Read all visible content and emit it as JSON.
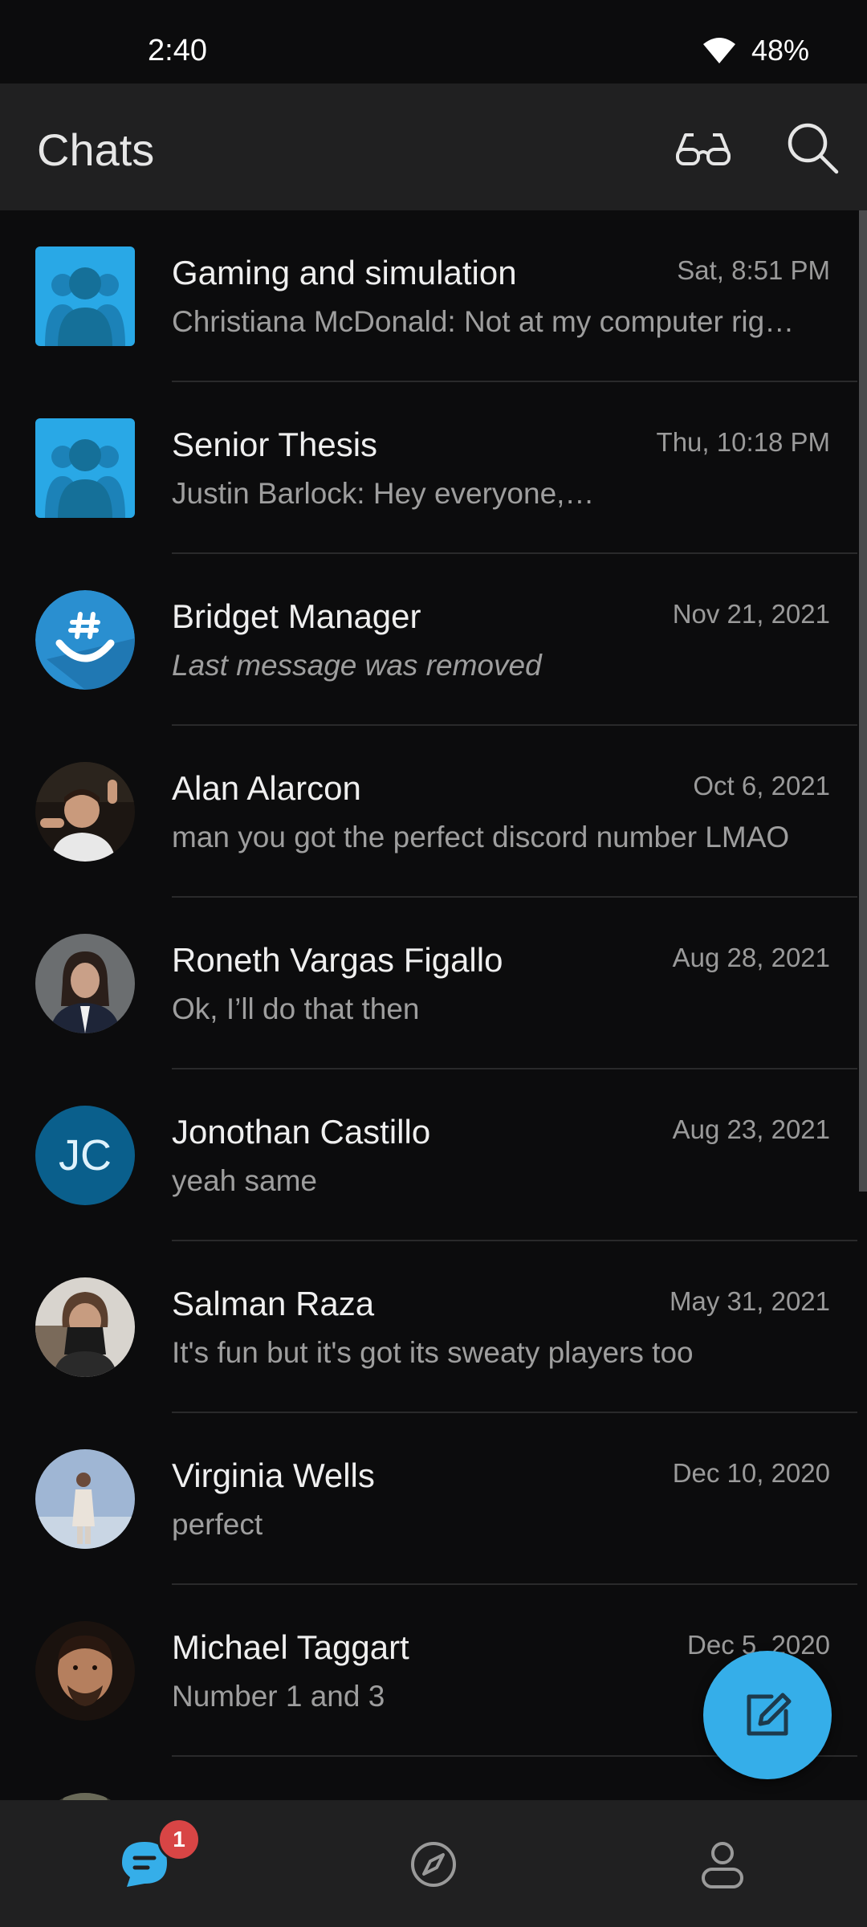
{
  "status": {
    "time": "2:40",
    "battery": "48%"
  },
  "header": {
    "title": "Chats"
  },
  "chats": [
    {
      "name": "Gaming and simulation",
      "date": "Sat, 8:51 PM",
      "message": "Christiana McDonald: Not at my computer rig…",
      "avatar": "group-icon"
    },
    {
      "name": "Senior Thesis",
      "date": "Thu, 10:18 PM",
      "message": "Justin Barlock: Hey everyone,…",
      "avatar": "group-icon"
    },
    {
      "name": "Bridget Manager",
      "date": "Nov 21, 2021",
      "message": "Last message was removed",
      "avatar": "groupme-logo"
    },
    {
      "name": "Alan Alarcon",
      "date": "Oct 6, 2021",
      "message": "man you got the perfect discord number LMAO",
      "avatar": "photo"
    },
    {
      "name": "Roneth Vargas Figallo",
      "date": "Aug 28, 2021",
      "message": "Ok, I’ll do that then",
      "avatar": "photo"
    },
    {
      "name": "Jonothan Castillo",
      "date": "Aug 23, 2021",
      "message": "yeah same",
      "avatar": "initials",
      "initials": "JC"
    },
    {
      "name": "Salman Raza",
      "date": "May 31, 2021",
      "message": "It's fun but it's got its sweaty players too",
      "avatar": "photo"
    },
    {
      "name": "Virginia Wells",
      "date": "Dec 10, 2020",
      "message": "perfect",
      "avatar": "photo"
    },
    {
      "name": "Michael Taggart",
      "date": "Dec 5, 2020",
      "message": "Number 1 and 3",
      "avatar": "photo"
    }
  ],
  "nav": {
    "chats_badge": "1"
  },
  "colors": {
    "accent": "#35aee9",
    "badge": "#d84545",
    "background": "#0c0c0d",
    "bar": "#202021"
  }
}
